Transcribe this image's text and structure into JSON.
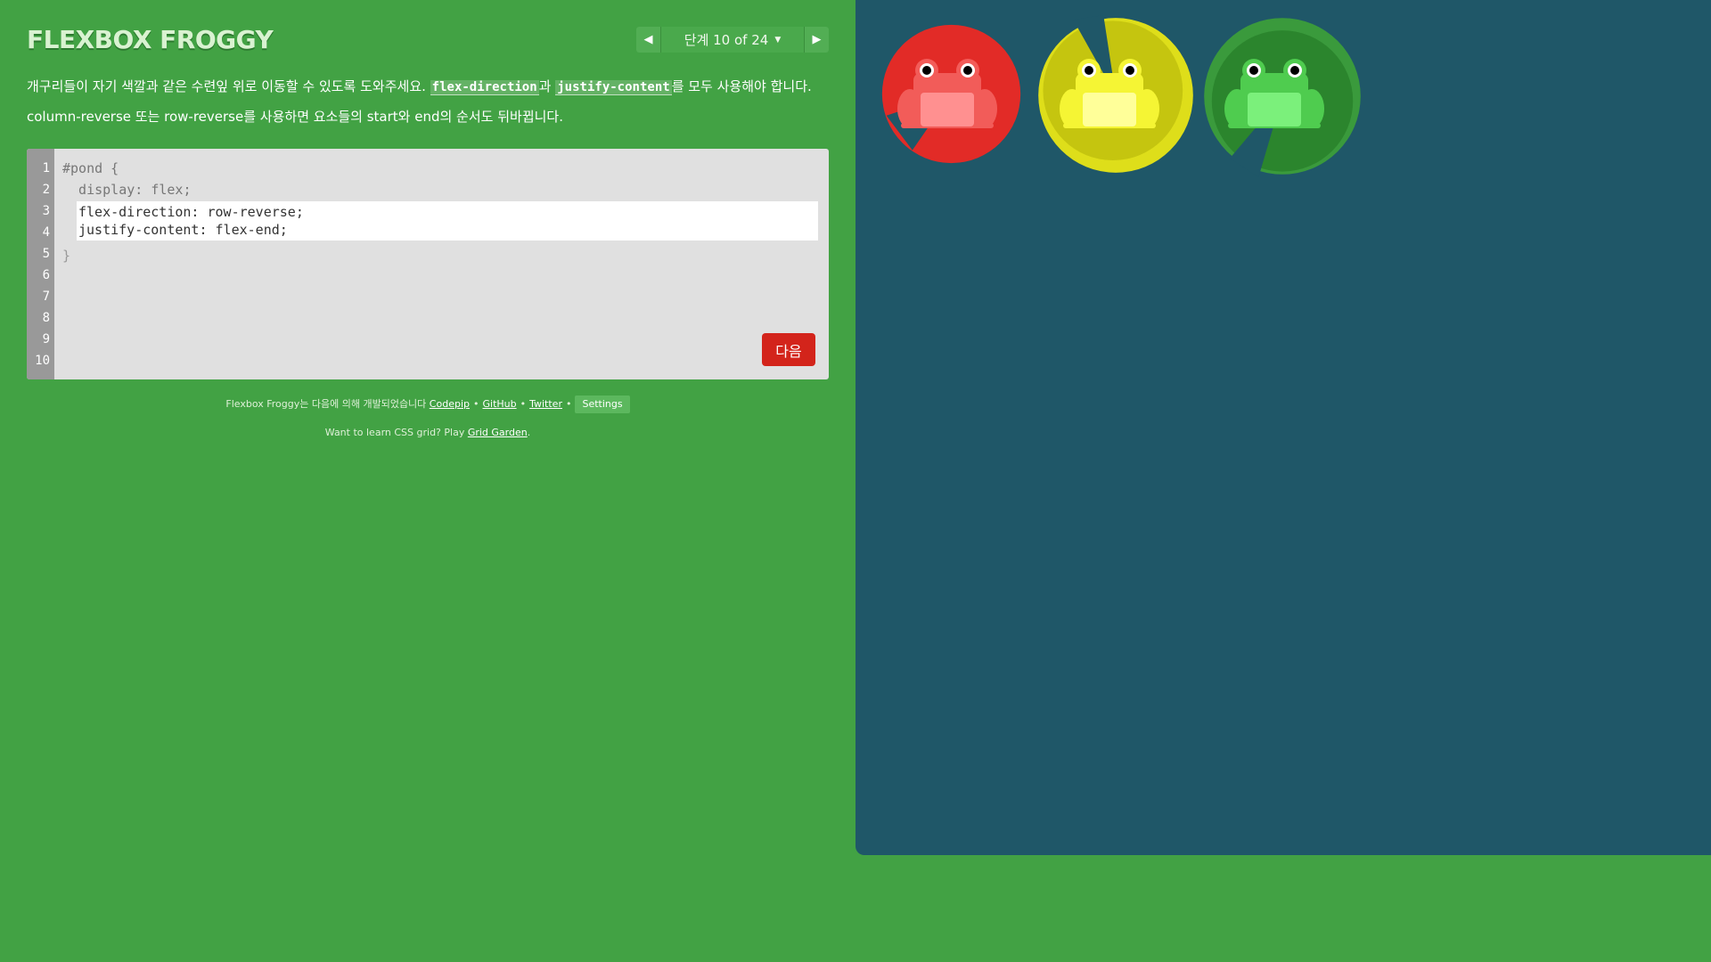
{
  "app": {
    "logo": "FLEXBOX FROGGY"
  },
  "level_nav": {
    "indicator": "단계 10 of 24",
    "prev_icon": "triangle-left-icon",
    "next_icon": "triangle-right-icon",
    "caret_icon": "caret-down-icon"
  },
  "instructions": {
    "p1_before": "개구리들이 자기 색깔과 같은 수련잎 위로 이동할 수 있도록 도와주세요. ",
    "kw1": "flex-direction",
    "p1_mid": "과 ",
    "kw2": "justify-content",
    "p1_after": "를 모두 사용해야 합니다.",
    "p2": "column-reverse 또는 row-reverse를 사용하면 요소들의 start와 end의 순서도 뒤바뀝니다."
  },
  "editor": {
    "line_numbers": [
      "1",
      "2",
      "3",
      "4",
      "5",
      "6",
      "7",
      "8",
      "9",
      "10"
    ],
    "line1": "#pond {",
    "line2": "  display: flex;",
    "line_close": "}",
    "input_value": "flex-direction: row-reverse;\njustify-content: flex-end;",
    "next_label": "다음"
  },
  "footer": {
    "credit_prefix": "Flexbox Froggy는 다음에 의해 개발되었습니다 ",
    "link_codepip": "Codepip",
    "link_github": "GitHub",
    "link_twitter": "Twitter",
    "bullet": "•",
    "settings_label": "Settings",
    "grid_prefix": "Want to learn CSS grid? Play ",
    "grid_link": "Grid Garden",
    "grid_suffix": "."
  },
  "pond": {
    "background": "#1f5768",
    "lilypads": [
      {
        "color": "red",
        "fill": "#e22b27",
        "dark": "#c81f1c"
      },
      {
        "color": "yellow",
        "fill": "#dede1a",
        "dark": "#c5c50f"
      },
      {
        "color": "green",
        "fill": "#3a9a3c",
        "dark": "#2b852d"
      }
    ],
    "frogs": [
      {
        "color": "red",
        "body": "#f25c59",
        "belly": "#ff9090"
      },
      {
        "color": "yellow",
        "body": "#f5f534",
        "belly": "#ffff99"
      },
      {
        "color": "green",
        "body": "#4fcc4f",
        "belly": "#7bf07b"
      }
    ]
  }
}
